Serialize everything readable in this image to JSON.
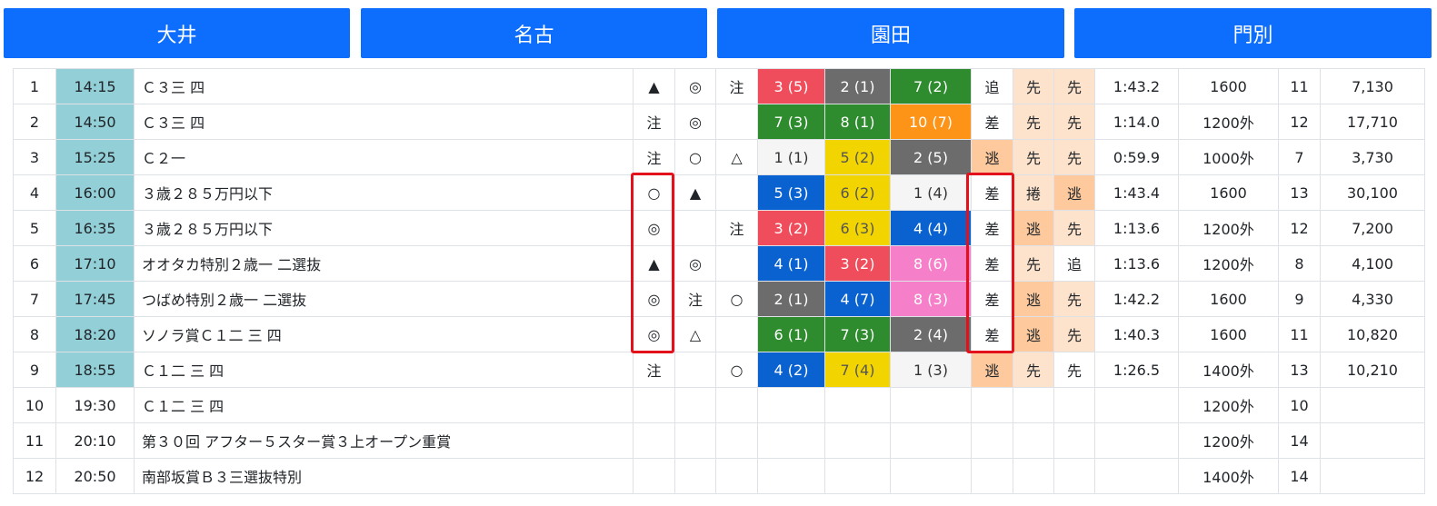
{
  "tabs": [
    "大井",
    "名古",
    "園田",
    "門別"
  ],
  "colors": {
    "tab_bg": "#0d6efd",
    "time_selected": "#92cfd7",
    "red": "#ef4d5b",
    "gray": "#6c6c6c",
    "green": "#2e8b2e",
    "orange": "#fd9418",
    "blue": "#0a62d0",
    "yellow": "#f2d400",
    "pink": "#f57fc8",
    "white": "#f5f5f5",
    "style_orange": "#fdc99d",
    "style_peach": "#fde3cc",
    "highlight": "#e3111b"
  },
  "races": [
    {
      "no": "1",
      "time": "14:15",
      "time_selected": true,
      "name": "Ｃ３三 四",
      "m1": "▲",
      "m2": "◎",
      "m3": "注",
      "r1": "3 (5)",
      "c1": "red",
      "r2": "2 (1)",
      "c2": "gray",
      "r3": "7 (2)",
      "c3": "green",
      "s1": "追",
      "sb1": "",
      "s2": "先",
      "sb2": "peach",
      "s3": "先",
      "sb3": "peach",
      "rec": "1:43.2",
      "dist": "1600",
      "heads": "11",
      "pay": "7,130"
    },
    {
      "no": "2",
      "time": "14:50",
      "time_selected": true,
      "name": "Ｃ３三 四",
      "m1": "注",
      "m2": "◎",
      "m3": "",
      "r1": "7 (3)",
      "c1": "green",
      "r2": "8 (1)",
      "c2": "green",
      "r3": "10 (7)",
      "c3": "orange",
      "s1": "差",
      "sb1": "",
      "s2": "先",
      "sb2": "peach",
      "s3": "先",
      "sb3": "peach",
      "rec": "1:14.0",
      "dist": "1200外",
      "heads": "12",
      "pay": "17,710"
    },
    {
      "no": "3",
      "time": "15:25",
      "time_selected": true,
      "name": "Ｃ２一",
      "m1": "注",
      "m2": "○",
      "m3": "△",
      "r1": "1 (1)",
      "c1": "white",
      "r2": "5 (2)",
      "c2": "yellow",
      "r3": "2 (5)",
      "c3": "gray",
      "s1": "逃",
      "sb1": "orange",
      "s2": "先",
      "sb2": "peach",
      "s3": "先",
      "sb3": "peach",
      "rec": "0:59.9",
      "dist": "1000外",
      "heads": "7",
      "pay": "3,730"
    },
    {
      "no": "4",
      "time": "16:00",
      "time_selected": true,
      "name": "３歳２８５万円以下",
      "m1": "○",
      "m2": "▲",
      "m3": "",
      "r1": "5 (3)",
      "c1": "blue",
      "r2": "6 (2)",
      "c2": "yellow",
      "r3": "1 (4)",
      "c3": "white",
      "s1": "差",
      "sb1": "",
      "s2": "捲",
      "sb2": "peach",
      "s3": "逃",
      "sb3": "orange",
      "rec": "1:43.4",
      "dist": "1600",
      "heads": "13",
      "pay": "30,100"
    },
    {
      "no": "5",
      "time": "16:35",
      "time_selected": true,
      "name": "３歳２８５万円以下",
      "m1": "◎",
      "m2": "",
      "m3": "注",
      "r1": "3 (2)",
      "c1": "red",
      "r2": "6 (3)",
      "c2": "yellow",
      "r3": "4 (4)",
      "c3": "blue",
      "s1": "差",
      "sb1": "",
      "s2": "逃",
      "sb2": "orange",
      "s3": "先",
      "sb3": "peach",
      "rec": "1:13.6",
      "dist": "1200外",
      "heads": "12",
      "pay": "7,200"
    },
    {
      "no": "6",
      "time": "17:10",
      "time_selected": true,
      "name": "オオタカ特別２歳一 二選抜",
      "m1": "▲",
      "m2": "◎",
      "m3": "",
      "r1": "4 (1)",
      "c1": "blue",
      "r2": "3 (2)",
      "c2": "red",
      "r3": "8 (6)",
      "c3": "pink",
      "s1": "差",
      "sb1": "",
      "s2": "先",
      "sb2": "peach",
      "s3": "追",
      "sb3": "",
      "rec": "1:13.6",
      "dist": "1200外",
      "heads": "8",
      "pay": "4,100"
    },
    {
      "no": "7",
      "time": "17:45",
      "time_selected": true,
      "name": "つばめ特別２歳一 二選抜",
      "m1": "◎",
      "m2": "注",
      "m3": "○",
      "r1": "2 (1)",
      "c1": "gray",
      "r2": "4 (7)",
      "c2": "blue",
      "r3": "8 (3)",
      "c3": "pink",
      "s1": "差",
      "sb1": "",
      "s2": "逃",
      "sb2": "orange",
      "s3": "先",
      "sb3": "peach",
      "rec": "1:42.2",
      "dist": "1600",
      "heads": "9",
      "pay": "4,330"
    },
    {
      "no": "8",
      "time": "18:20",
      "time_selected": true,
      "name": "ソノラ賞Ｃ１二 三 四",
      "m1": "◎",
      "m2": "△",
      "m3": "",
      "r1": "6 (1)",
      "c1": "green",
      "r2": "7 (3)",
      "c2": "green",
      "r3": "2 (4)",
      "c3": "gray",
      "s1": "差",
      "sb1": "",
      "s2": "逃",
      "sb2": "orange",
      "s3": "先",
      "sb3": "peach",
      "rec": "1:40.3",
      "dist": "1600",
      "heads": "11",
      "pay": "10,820"
    },
    {
      "no": "9",
      "time": "18:55",
      "time_selected": true,
      "name": "Ｃ１二 三 四",
      "m1": "注",
      "m2": "",
      "m3": "○",
      "r1": "4 (2)",
      "c1": "blue",
      "r2": "7 (4)",
      "c2": "yellow",
      "r3": "1 (3)",
      "c3": "white",
      "s1": "逃",
      "sb1": "orange",
      "s2": "先",
      "sb2": "peach",
      "s3": "先",
      "sb3": "",
      "rec": "1:26.5",
      "dist": "1400外",
      "heads": "13",
      "pay": "10,210"
    },
    {
      "no": "10",
      "time": "19:30",
      "time_selected": false,
      "name": "Ｃ１二 三 四",
      "m1": "",
      "m2": "",
      "m3": "",
      "r1": "",
      "c1": "",
      "r2": "",
      "c2": "",
      "r3": "",
      "c3": "",
      "s1": "",
      "sb1": "",
      "s2": "",
      "sb2": "",
      "s3": "",
      "sb3": "",
      "rec": "",
      "dist": "1200外",
      "heads": "10",
      "pay": ""
    },
    {
      "no": "11",
      "time": "20:10",
      "time_selected": false,
      "name": "第３０回 アフター５スター賞３上オープン重賞",
      "m1": "",
      "m2": "",
      "m3": "",
      "r1": "",
      "c1": "",
      "r2": "",
      "c2": "",
      "r3": "",
      "c3": "",
      "s1": "",
      "sb1": "",
      "s2": "",
      "sb2": "",
      "s3": "",
      "sb3": "",
      "rec": "",
      "dist": "1200外",
      "heads": "14",
      "pay": ""
    },
    {
      "no": "12",
      "time": "20:50",
      "time_selected": false,
      "name": "南部坂賞Ｂ３三選抜特別",
      "m1": "",
      "m2": "",
      "m3": "",
      "r1": "",
      "c1": "",
      "r2": "",
      "c2": "",
      "r3": "",
      "c3": "",
      "s1": "",
      "sb1": "",
      "s2": "",
      "sb2": "",
      "s3": "",
      "sb3": "",
      "rec": "",
      "dist": "1400外",
      "heads": "14",
      "pay": ""
    }
  ]
}
